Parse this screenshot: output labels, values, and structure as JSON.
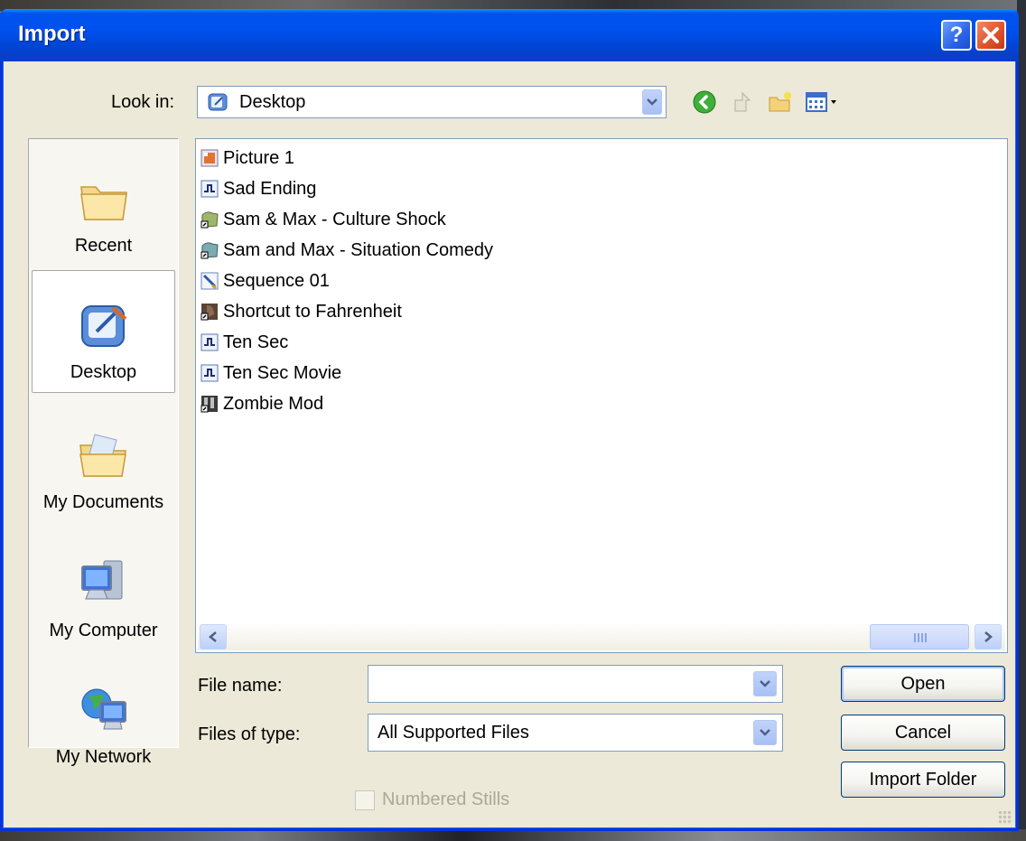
{
  "window": {
    "title": "Import"
  },
  "look_in": {
    "label": "Look in:",
    "value": "Desktop"
  },
  "places": [
    {
      "label": "Recent",
      "icon": "folder-icon"
    },
    {
      "label": "Desktop",
      "icon": "desktop-icon",
      "selected": true
    },
    {
      "label": "My Documents",
      "icon": "my-documents-icon"
    },
    {
      "label": "My Computer",
      "icon": "my-computer-icon"
    },
    {
      "label": "My Network",
      "icon": "my-network-icon"
    }
  ],
  "files": [
    {
      "name": "Picture 1",
      "icon": "picture-icon"
    },
    {
      "name": "Sad Ending",
      "icon": "media-file-icon"
    },
    {
      "name": "Sam & Max - Culture Shock",
      "icon": "game-shortcut-icon"
    },
    {
      "name": "Sam and Max - Situation Comedy",
      "icon": "game-shortcut-icon"
    },
    {
      "name": "Sequence 01",
      "icon": "sequence-icon"
    },
    {
      "name": "Shortcut to Fahrenheit",
      "icon": "game-shortcut-icon"
    },
    {
      "name": "Ten Sec",
      "icon": "media-file-icon"
    },
    {
      "name": "Ten Sec Movie",
      "icon": "media-file-icon"
    },
    {
      "name": "Zombie Mod",
      "icon": "app-shortcut-icon"
    }
  ],
  "file_name": {
    "label": "File name:",
    "value": "",
    "placeholder": ""
  },
  "file_type": {
    "label": "Files of type:",
    "value": "All Supported Files"
  },
  "buttons": {
    "open": "Open",
    "cancel": "Cancel",
    "import_folder": "Import Folder"
  },
  "numbered_stills": {
    "label": "Numbered Stills",
    "checked": false,
    "enabled": false
  },
  "colors": {
    "titlebar": "#0053ee",
    "dialog_bg": "#ece9d8",
    "accent": "#7f9db9"
  }
}
